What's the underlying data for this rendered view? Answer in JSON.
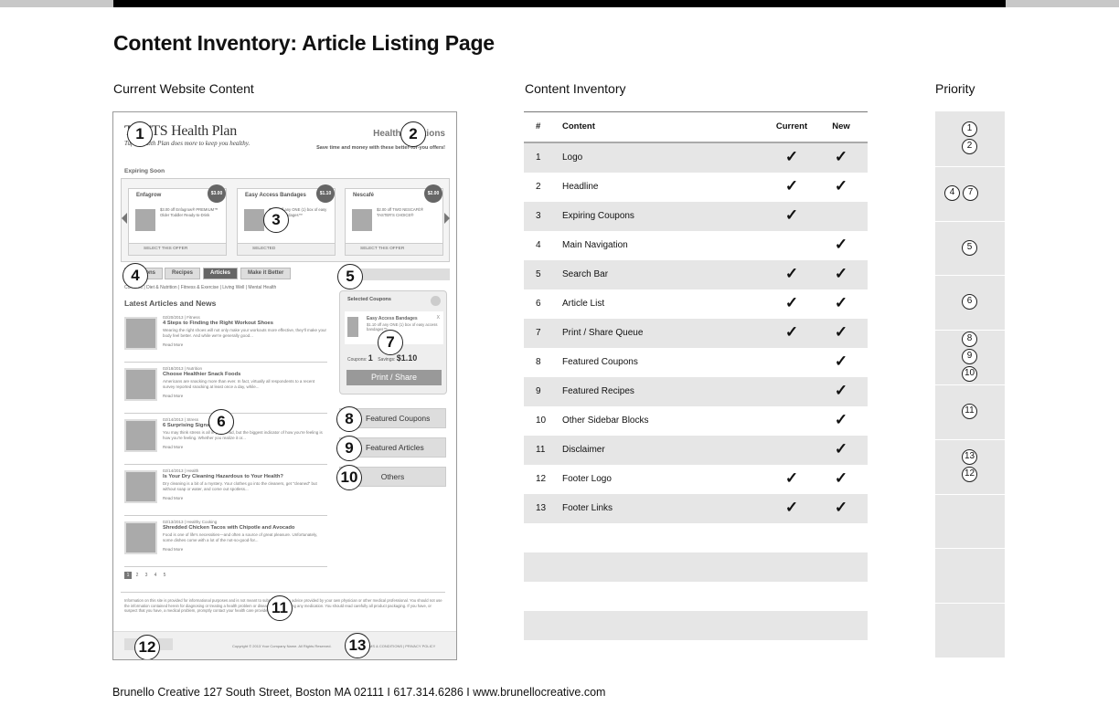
{
  "page": {
    "title": "Content Inventory: Article Listing Page",
    "footer": "Brunello Creative 127 South Street, Boston MA 02111 I 617.314.6286 I www.brunellocreative.com"
  },
  "sections": {
    "current": "Current Website Content",
    "inventory": "Content Inventory",
    "priority": "Priority"
  },
  "wireframe": {
    "logo": "TUFTS Health Plan",
    "tagline": "Tufts Health Plan does more to keep you healthy.",
    "headline": "Health Solutions",
    "headline_sub": "Save time and money with these better-for-you offers!",
    "expiring_label": "Expiring Soon",
    "coupons": [
      {
        "name": "Enfagrow",
        "price": "$3.00",
        "text": "$3.00 off Enfagrow® PREMIUM™ Older Toddler Ready-to-Drink",
        "footer": "SELECT THIS OFFER"
      },
      {
        "name": "Easy Access Bandages",
        "price": "$1.10",
        "text": "$1.10 off any ONE (1) box of easy access bandages™",
        "footer": "SELECTED"
      },
      {
        "name": "Nescafé",
        "price": "$2.00",
        "text": "$2.00 off TWO NESCAFÉ® TASTER'S CHOICE®",
        "footer": "SELECT THIS OFFER"
      }
    ],
    "nav_tabs": [
      "Coupons",
      "Recipes",
      "Articles",
      "Make it Better"
    ],
    "subnav": "Contents | Diet & Nutrition | Fitness & Exercise | Living Well | Mental Health",
    "latest_heading": "Latest Articles and News",
    "articles": [
      {
        "meta": "02/20/2013 | Fitness",
        "title": "4 Steps to Finding the Right Workout Shoes",
        "desc": "Wearing the right shoes will not only make your workouts more effective, they'll make your body feel better. And while we're generally good...",
        "more": "Read More"
      },
      {
        "meta": "02/18/2013 | Nutrition",
        "title": "Choose Healthier Snack Foods",
        "desc": "Americans are snacking more than ever. In fact, virtually all respondents to a recent survey reported snacking at least once a day, while...",
        "more": "Read More"
      },
      {
        "meta": "02/14/2013 | Stress",
        "title": "6 Surprising Signs of Stress",
        "desc": "You may think stress is all in your head, but the biggest indicator of how you're feeling is how you're feeling. Whether you realize it or...",
        "more": "Read More"
      },
      {
        "meta": "02/14/2013 | Health",
        "title": "Is Your Dry Cleaning Hazardous to Your Health?",
        "desc": "Dry cleaning is a bit of a mystery. Your clothes go into the cleaners, get \"cleaned\" but without soap or water, and come out spotless...",
        "more": "Read More"
      },
      {
        "meta": "02/13/2013 | Healthy Cooking",
        "title": "Shredded Chicken Tacos with Chipotle and Avocado",
        "desc": "Food is one of life's necessities—and often a source of great pleasure. Unfortunately, some dishes come with a lot of the not-so-good-for...",
        "more": "Read More"
      }
    ],
    "selected_coupons": {
      "heading": "Selected Coupons",
      "item_name": "Easy Access Bandages",
      "item_desc": "$1.10 off any ONE (1) box of easy access bandages™",
      "close": "X",
      "coupons_label": "Coupons:",
      "coupons_count": "1",
      "savings_label": "Savings:",
      "savings_value": "$1.10",
      "button": "Print / Share"
    },
    "sidebar_blocks": [
      "Featured Coupons",
      "Featured Articles",
      "Others"
    ],
    "pages": [
      "1",
      "2",
      "3",
      "4",
      "5"
    ],
    "disclaimer": "Information on this site is provided for informational purposes and is not meant to substitute for the advice provided by your own physician or other medical professional. You should not use the information contained herein for diagnosing or treating a health problem or disease, or prescribing any medication. You should read carefully all product packaging. If you have, or suspect that you have, a medical problem, promptly contact your health care provider.",
    "copyright": "Copyright © 2013 Your Company Name. All Rights Reserved.",
    "links": "TERMS & CONDITIONS  |  PRIVACY POLICY",
    "markers": [
      "1",
      "2",
      "3",
      "4",
      "5",
      "6",
      "7",
      "8",
      "9",
      "10",
      "11",
      "12",
      "13"
    ]
  },
  "inventory": {
    "headers": {
      "num": "#",
      "content": "Content",
      "current": "Current",
      "new": "New"
    },
    "check": "✓",
    "rows": [
      {
        "num": "1",
        "name": "Logo",
        "current": true,
        "new": true
      },
      {
        "num": "2",
        "name": "Headline",
        "current": true,
        "new": true
      },
      {
        "num": "3",
        "name": "Expiring Coupons",
        "current": true,
        "new": false
      },
      {
        "num": "4",
        "name": "Main Navigation",
        "current": false,
        "new": true
      },
      {
        "num": "5",
        "name": "Search Bar",
        "current": true,
        "new": true
      },
      {
        "num": "6",
        "name": "Article List",
        "current": true,
        "new": true
      },
      {
        "num": "7",
        "name": "Print / Share Queue",
        "current": true,
        "new": true
      },
      {
        "num": "8",
        "name": "Featured Coupons",
        "current": false,
        "new": true
      },
      {
        "num": "9",
        "name": "Featured Recipes",
        "current": false,
        "new": true
      },
      {
        "num": "10",
        "name": "Other Sidebar Blocks",
        "current": false,
        "new": true
      },
      {
        "num": "11",
        "name": "Disclaimer",
        "current": false,
        "new": true
      },
      {
        "num": "12",
        "name": "Footer Logo",
        "current": true,
        "new": true
      },
      {
        "num": "13",
        "name": "Footer Links",
        "current": true,
        "new": true
      }
    ]
  },
  "priority": {
    "groups": [
      [
        "1",
        "2"
      ],
      [
        "4",
        "7"
      ],
      [
        "5"
      ],
      [
        "6"
      ],
      [
        "8",
        "9",
        "10"
      ],
      [
        "11"
      ],
      [
        "13",
        "12"
      ],
      [],
      [],
      []
    ]
  }
}
